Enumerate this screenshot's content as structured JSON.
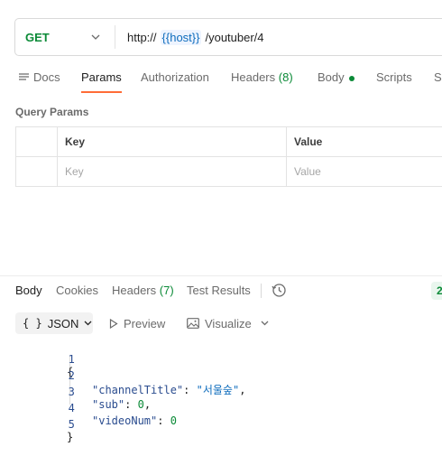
{
  "request": {
    "method": "GET",
    "url_prefix": "http://",
    "url_var": "{{host}}",
    "url_path": "/youtuber/4"
  },
  "tabs": {
    "docs": "Docs",
    "params": "Params",
    "authorization": "Authorization",
    "headers_label": "Headers",
    "headers_count": "(8)",
    "body": "Body",
    "scripts": "Scripts",
    "settings_partial": "Se"
  },
  "query_params": {
    "title": "Query Params",
    "headers": {
      "key": "Key",
      "value": "Value"
    },
    "placeholders": {
      "key": "Key",
      "value": "Value"
    }
  },
  "response": {
    "tabs": {
      "body": "Body",
      "cookies": "Cookies",
      "headers_label": "Headers",
      "headers_count": "(7)",
      "test_results": "Test Results"
    },
    "status_partial": "2",
    "format": "JSON",
    "format_braces": "{ }",
    "preview": "Preview",
    "visualize": "Visualize",
    "lines": [
      {
        "n": "1",
        "text": "{"
      },
      {
        "n": "2",
        "key": "\"channelTitle\"",
        "sep": ": ",
        "val": "\"서울숲\"",
        "end": ","
      },
      {
        "n": "3",
        "key": "\"sub\"",
        "sep": ": ",
        "val": "0",
        "end": ","
      },
      {
        "n": "4",
        "key": "\"videoNum\"",
        "sep": ": ",
        "val": "0",
        "end": ""
      },
      {
        "n": "5",
        "text": "}"
      }
    ]
  },
  "colors": {
    "accent": "#ff6c37",
    "method": "#0b8a37",
    "variable": "#0f6dbd"
  }
}
